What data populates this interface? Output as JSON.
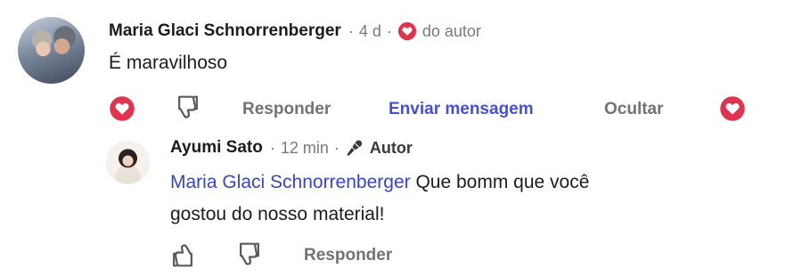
{
  "comment": {
    "author": "Maria Glaci Schnorrenberger",
    "sep1": "·",
    "time": "4 d",
    "sep2": "·",
    "author_like_label": "do autor",
    "text": "É maravilhoso",
    "actions": {
      "reply": "Responder",
      "send_message": "Enviar mensagem",
      "hide": "Ocultar"
    }
  },
  "reply": {
    "author": "Ayumi Sato",
    "sep1": "·",
    "time": "12 min",
    "sep2": "·",
    "badge": "Autor",
    "mention": "Maria Glaci Schnorrenberger",
    "text_line1": " Que bomm que você",
    "text_line2": "gostou do nosso material!",
    "actions": {
      "reply": "Responder"
    }
  },
  "colors": {
    "heart": "#e0334f",
    "mention": "#3845c5",
    "action_gray": "#737373",
    "action_blue": "#4651d2"
  },
  "icons": [
    "heart-icon",
    "dislike-icon",
    "mic-icon",
    "like-icon"
  ]
}
